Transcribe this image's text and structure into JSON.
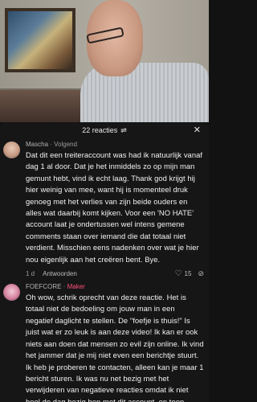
{
  "sheet": {
    "title": "22 reacties",
    "filter_icon": "filter-icon",
    "close_icon": "close-icon"
  },
  "comments": [
    {
      "author": "Mascha",
      "separator": "·",
      "tag": "Volgend",
      "text": "Dat dit een treiteraccount was had ik natuurlijk vanaf dag 1 al door. Dat je het inmiddels zo op mijn man gemunt hebt, vind ik echt laag. Thank god krijgt hij hier weinig van mee, want hij is momenteel druk genoeg met het verlies van zijn beide ouders en alles wat daarbij komt kijken. Voor een 'NO HATE' account laat je ondertussen wel intens gemene comments staan over iemand die dat totaal niet verdient. Misschien eens nadenken over wat je hier nou eigenlijk aan het creëren bent. Bye.",
      "age": "1 d",
      "reply_label": "Antwoorden",
      "likes": "15"
    },
    {
      "author": "FOEFCORE",
      "separator": "·",
      "tag": "Maker",
      "text": "Oh wow, schrik oprecht van deze reactie. Het is totaal niet de bedoeling om jouw man in een negatief daglicht te stellen. De \"foefje is thuis!\" Is juist wat er zo leuk is aan deze video! Ik kan er ook niets aan doen dat mensen zo evil zijn online. Ik vind het jammer dat je mij niet even een berichtje stuurt. Ik heb je proberen te contacten, alleen kan je maar 1 bericht sturen. Ik was nu net bezig met het verwijderen van negatieve reacties omdat ik niet heel de dag bezig ben met dit account, en toen kwam ik"
    }
  ]
}
